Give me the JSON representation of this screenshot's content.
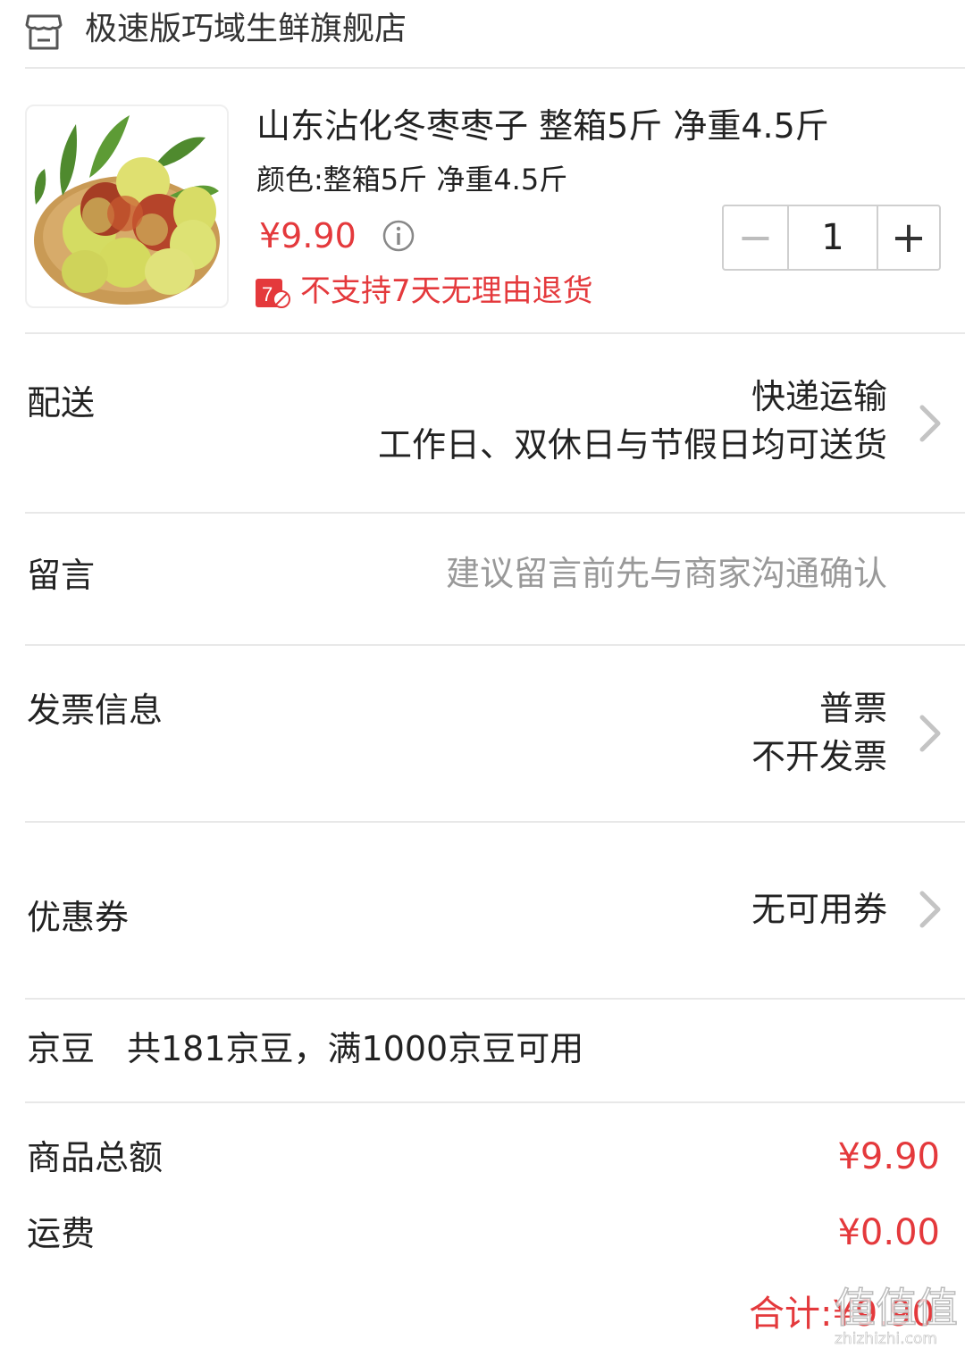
{
  "store": {
    "name": "极速版巧域生鲜旗舰店",
    "icon": "store-icon"
  },
  "product": {
    "title": "山东沾化冬枣枣子 整箱5斤 净重4.5斤",
    "spec": "颜色:整箱5斤 净重4.5斤",
    "price": "¥9.90",
    "return_policy": "不支持7天无理由退货",
    "return_badge_text": "7",
    "quantity": "1",
    "minus_symbol": "−",
    "plus_symbol": "+"
  },
  "delivery": {
    "label": "配送",
    "method": "快递运输",
    "schedule": "工作日、双休日与节假日均可送货"
  },
  "message": {
    "label": "留言",
    "placeholder": "建议留言前先与商家沟通确认"
  },
  "invoice": {
    "label": "发票信息",
    "type": "普票",
    "status": "不开发票"
  },
  "coupon": {
    "label": "优惠券",
    "value": "无可用券"
  },
  "jingdou": {
    "label": "京豆",
    "info": "共181京豆，满1000京豆可用"
  },
  "summary": {
    "goods_total_label": "商品总额",
    "goods_total_value": "¥9.90",
    "shipping_label": "运费",
    "shipping_value": "¥0.00",
    "grand_total": "合计:¥9.90"
  },
  "watermark": {
    "text": "值值值",
    "sub": "zhizhizhi.com"
  },
  "colors": {
    "accent": "#e4393c",
    "divider": "#e8e8e8",
    "placeholder": "#999999"
  }
}
